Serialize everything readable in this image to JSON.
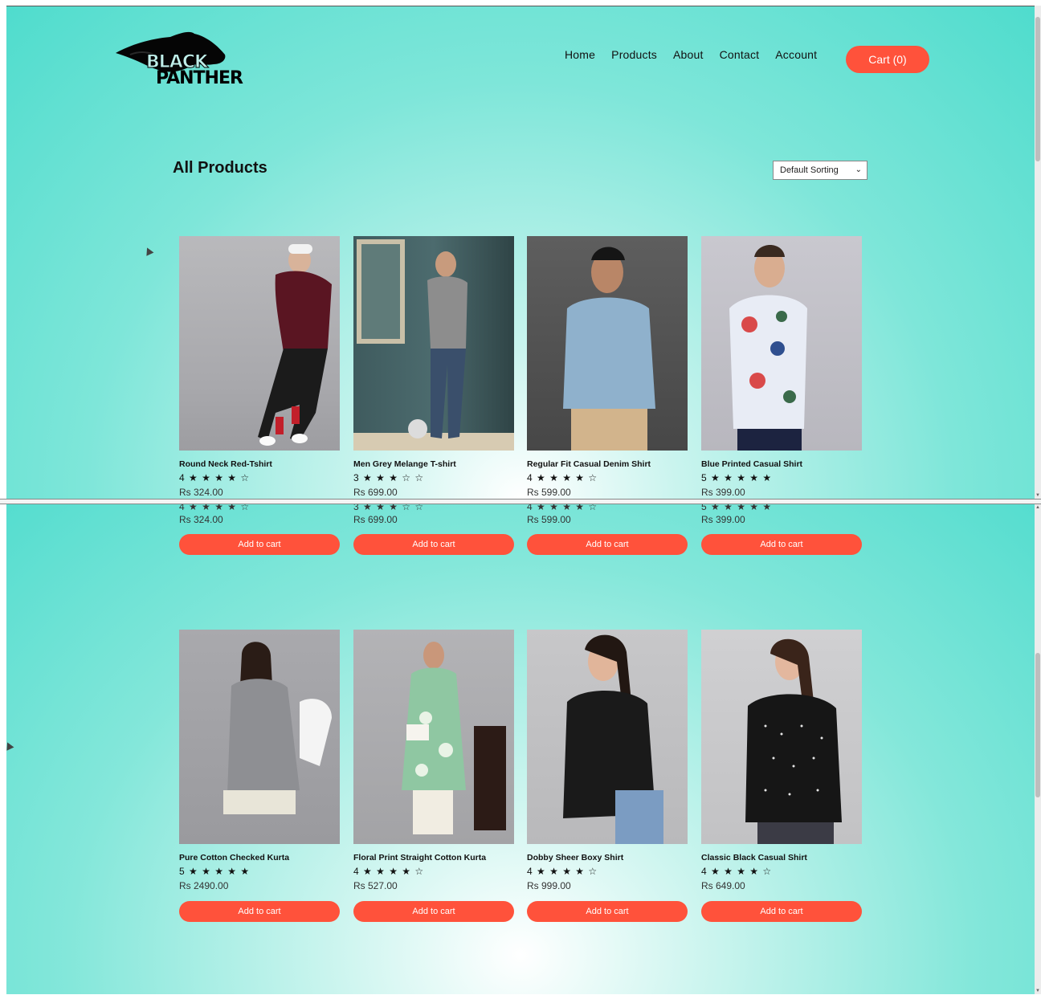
{
  "brand": {
    "logo_line1": "BLACK",
    "logo_line2": "PANTHER"
  },
  "nav": {
    "items": [
      "Home",
      "Products",
      "About",
      "Contact",
      "Account"
    ],
    "cart_label": "Cart (0)"
  },
  "page": {
    "title": "All Products",
    "sort_selected": "Default Sorting"
  },
  "colors": {
    "accent": "#ff523b",
    "background": "#6fe3d6"
  },
  "products": [
    {
      "name": "Round Neck Red-Tshirt",
      "rating": "4 ★ ★ ★ ★ ☆",
      "price": "Rs 324.00",
      "button": "Add to cart"
    },
    {
      "name": "Men Grey Melange T-shirt",
      "rating": "3 ★ ★ ★ ☆ ☆",
      "price": "Rs 699.00",
      "button": "Add to cart"
    },
    {
      "name": "Regular Fit Casual Denim Shirt",
      "rating": "4 ★ ★ ★ ★ ☆",
      "price": "Rs 599.00",
      "button": "Add to cart"
    },
    {
      "name": "Blue Printed Casual Shirt",
      "rating": "5 ★ ★ ★ ★ ★",
      "price": "Rs 399.00",
      "button": "Add to cart"
    },
    {
      "name": "Pure Cotton Checked Kurta",
      "rating": "5 ★ ★ ★ ★ ★",
      "price": "Rs 2490.00",
      "button": "Add to cart"
    },
    {
      "name": "Floral Print Straight Cotton Kurta",
      "rating": "4 ★ ★ ★ ★ ☆",
      "price": "Rs 527.00",
      "button": "Add to cart"
    },
    {
      "name": "Dobby Sheer Boxy Shirt",
      "rating": "4 ★ ★ ★ ★ ☆",
      "price": "Rs 999.00",
      "button": "Add to cart"
    },
    {
      "name": "Classic Black Casual Shirt",
      "rating": "4 ★ ★ ★ ★ ☆",
      "price": "Rs 649.00",
      "button": "Add to cart"
    }
  ]
}
